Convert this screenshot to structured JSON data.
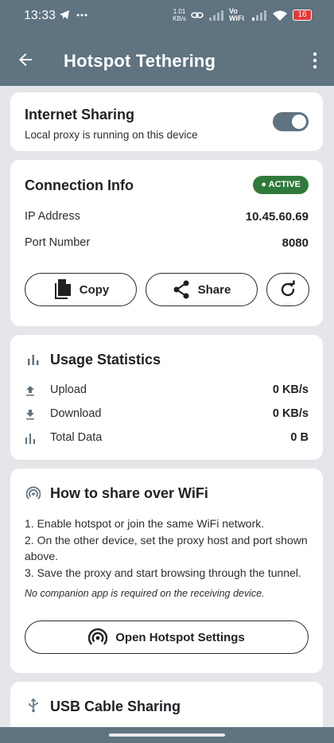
{
  "status_bar": {
    "time": "13:33",
    "left_icons": "◢ ···",
    "net_speed_value": "1.01",
    "net_speed_unit": "KB/s",
    "volte": "Vo WiFi",
    "battery": "16"
  },
  "app_bar": {
    "title": "Hotspot Tethering",
    "back_icon": "arrow-back-icon",
    "menu_icon": "more-vert-icon"
  },
  "internet_sharing": {
    "title": "Internet Sharing",
    "subtitle": "Local proxy is running on this device",
    "toggle_on": true
  },
  "connection_info": {
    "title": "Connection Info",
    "badge": "● ACTIVE",
    "ip_label": "IP Address",
    "ip_value": "10.45.60.69",
    "port_label": "Port Number",
    "port_value": "8080",
    "copy_label": "Copy",
    "share_label": "Share"
  },
  "usage_statistics": {
    "title": "Usage Statistics",
    "rows": [
      {
        "label": "Upload",
        "value": "0 KB/s",
        "icon": "upload-icon"
      },
      {
        "label": "Download",
        "value": "0 KB/s",
        "icon": "download-icon"
      },
      {
        "label": "Total Data",
        "value": "0 B",
        "icon": "bar-chart-icon"
      }
    ]
  },
  "how_to_share": {
    "title": "How to share over WiFi",
    "steps": [
      "1. Enable hotspot or join the same WiFi network.",
      "2. On the other device, set the proxy host and port shown above.",
      "3. Save the proxy and start browsing through the tunnel."
    ],
    "note": "No companion app is required on the receiving device.",
    "button_label": "Open Hotspot Settings"
  },
  "usb_sharing": {
    "title": "USB Cable Sharing"
  },
  "colors": {
    "primary": "#5f7380",
    "active_green": "#2f7a3a",
    "background": "#e4e6e9"
  }
}
